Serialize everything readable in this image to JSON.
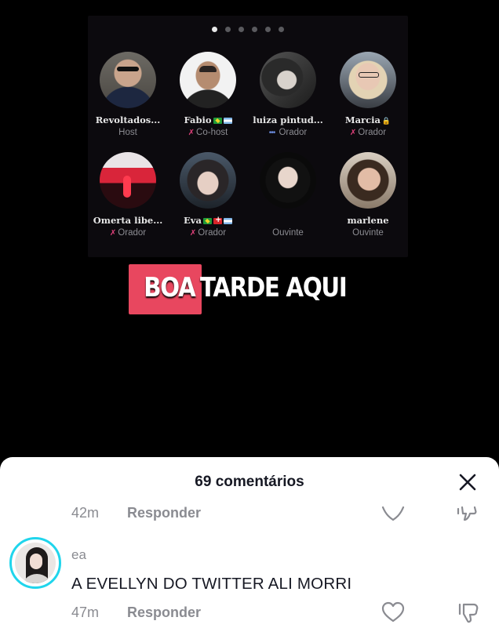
{
  "video": {
    "caption_highlight": "BOA",
    "caption_rest": "TARDE AQUI",
    "page_dots": 6,
    "active_dot": 0,
    "participants": [
      {
        "name": "Revoltados...",
        "role": "Host",
        "flags": []
      },
      {
        "name": "Fabio",
        "role": "Co-host",
        "flags": [
          "br",
          "ar"
        ]
      },
      {
        "name": "luiza pintud...",
        "role": "Orador",
        "flags": []
      },
      {
        "name": "Marcia",
        "role": "Orador",
        "flags": []
      },
      {
        "name": "Omerta libe...",
        "role": "Orador",
        "flags": []
      },
      {
        "name": "Eva",
        "role": "Orador",
        "flags": [
          "br",
          "ch",
          "ar"
        ]
      },
      {
        "name": "",
        "role": "Ouvinte",
        "flags": []
      },
      {
        "name": "marlene",
        "role": "Ouvinte",
        "flags": []
      }
    ]
  },
  "comments": {
    "title": "69 comentários",
    "previous": {
      "time": "42m",
      "reply_label": "Responder"
    },
    "items": [
      {
        "username": "ea",
        "text": "A EVELLYN DO TWITTER ALI MORRI",
        "time": "47m",
        "reply_label": "Responder"
      }
    ]
  },
  "colors": {
    "caption_highlight": "#e8475f",
    "avatar_ring": "#20d5ec",
    "cohost_icon": "#e0407a",
    "sheet_bg": "#ffffff"
  },
  "icons": [
    "close-icon",
    "heart-icon",
    "dislike-icon",
    "lock-icon"
  ]
}
